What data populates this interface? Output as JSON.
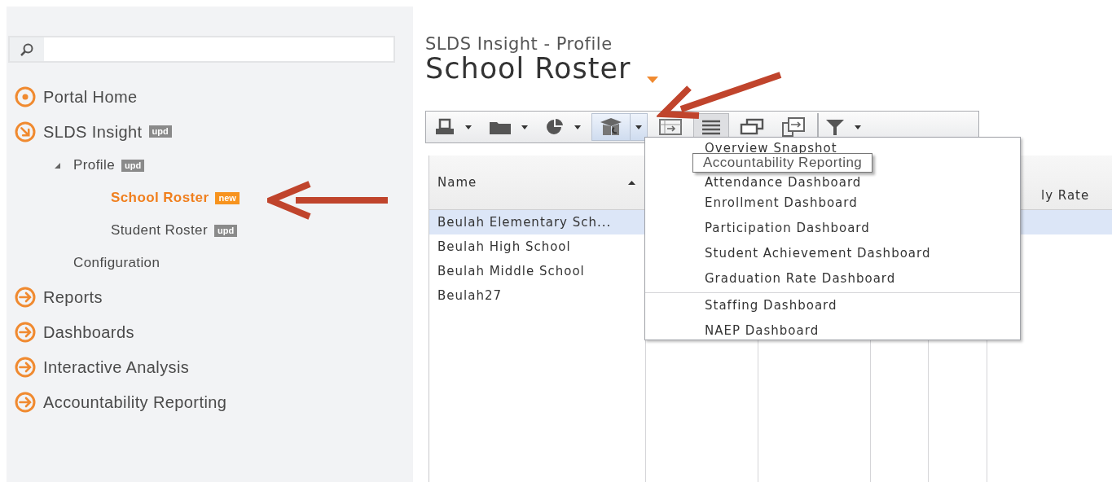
{
  "sidebar": {
    "items": [
      {
        "label": "Portal Home",
        "kind": "home",
        "selected": false
      },
      {
        "label": "SLDS Insight",
        "kind": "section",
        "badge": {
          "text": "upd",
          "kind": "update"
        },
        "selected": false,
        "expanded": true,
        "children": [
          {
            "label": "Profile",
            "badge": {
              "text": "upd",
              "kind": "update"
            },
            "selected": false,
            "expanded": true,
            "children": [
              {
                "label": "School Roster",
                "badge": {
                  "text": "new",
                  "kind": "new"
                },
                "selected": true
              },
              {
                "label": "Student Roster",
                "badge": {
                  "text": "upd",
                  "kind": "update"
                },
                "selected": false
              }
            ]
          },
          {
            "label": "Configuration",
            "selected": false
          }
        ]
      },
      {
        "label": "Reports",
        "kind": "section",
        "selected": false,
        "expanded": false
      },
      {
        "label": "Dashboards",
        "kind": "section",
        "selected": false,
        "expanded": false
      },
      {
        "label": "Interactive Analysis",
        "kind": "section",
        "selected": false,
        "expanded": false
      },
      {
        "label": "Accountability Reporting",
        "kind": "section",
        "selected": false,
        "expanded": false
      }
    ]
  },
  "header": {
    "subtitle": "SLDS Insight - Profile",
    "title": "School Roster"
  },
  "toolbar": [
    {
      "kind": "print",
      "dropdown": true,
      "split": false,
      "pressed": false
    },
    {
      "kind": "folder",
      "dropdown": true,
      "split": false,
      "pressed": false
    },
    {
      "kind": "chart",
      "dropdown": true,
      "split": false,
      "pressed": false
    },
    {
      "kind": "education",
      "dropdown": true,
      "split": true,
      "pressed": true
    },
    {
      "kind": "import",
      "dropdown": false,
      "pressed": false
    },
    {
      "kind": "list",
      "dropdown": false,
      "pressed": true
    },
    {
      "kind": "windows",
      "dropdown": false,
      "pressed": false
    },
    {
      "kind": "export",
      "dropdown": false,
      "pressed": false
    },
    {
      "kind": "filter",
      "dropdown": true,
      "split": false,
      "pressed": false
    }
  ],
  "table": {
    "columns": [
      {
        "label": "Name",
        "sorted_ascending": true
      },
      {
        "label": "ly Rate"
      }
    ],
    "rows": [
      {
        "name": "Beulah Elementary Sch...",
        "selected": true
      },
      {
        "name": "Beulah High School",
        "selected": false
      },
      {
        "name": "Beulah Middle School",
        "selected": false
      },
      {
        "name": "Beulah27",
        "selected": false
      }
    ]
  },
  "menu": {
    "items": [
      {
        "label": "Overview Snapshot",
        "separator_before": false
      },
      {
        "label": "Attendance Dashboard",
        "separator_before": false
      },
      {
        "label": "Enrollment Dashboard",
        "separator_before": false
      },
      {
        "label": "Participation Dashboard",
        "separator_before": false
      },
      {
        "label": "Student Achievement Dashboard",
        "separator_before": false
      },
      {
        "label": "Graduation Rate Dashboard",
        "separator_before": false
      },
      {
        "label": "Staffing Dashboard",
        "separator_before": true
      },
      {
        "label": "NAEP Dashboard",
        "separator_before": false
      }
    ],
    "tooltip": "Accountability Reporting"
  }
}
